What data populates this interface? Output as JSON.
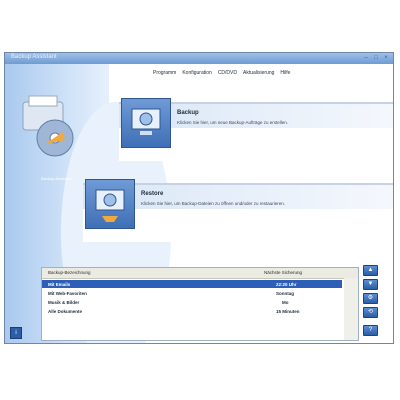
{
  "window": {
    "title": "Backup Assistant",
    "accent": "#2d5fb8"
  },
  "menu": [
    "Programm",
    "Konfiguration",
    "CD/DVD",
    "Aktualisierung",
    "Hilfe"
  ],
  "logo_caption": "Backup Assistant",
  "backup": {
    "title": "Backup",
    "description": "Klicken Sie hier, um neue Backup-Aufträge zu erstellen."
  },
  "restore": {
    "title": "Restore",
    "description": "Klicken Sie hier, um Backup-Dateien zu öffnen und/oder zu restaurieren."
  },
  "list": {
    "columns": [
      "Backup-Bezeichnung",
      "Nächste Sicherung"
    ],
    "rows": [
      {
        "name": "Mit Emails",
        "next": "22:20 Uhr",
        "selected": true
      },
      {
        "name": "Mit Web-Favoriten",
        "next": "Sonntag",
        "selected": false
      },
      {
        "name": "Musik & Bilder",
        "next": "Mo",
        "selected": false
      },
      {
        "name": "Alle Dokumente",
        "next": "15 Minuten",
        "selected": false
      }
    ]
  },
  "side_buttons": [
    "▲",
    "▼",
    "⚙",
    "⟲",
    "?"
  ]
}
